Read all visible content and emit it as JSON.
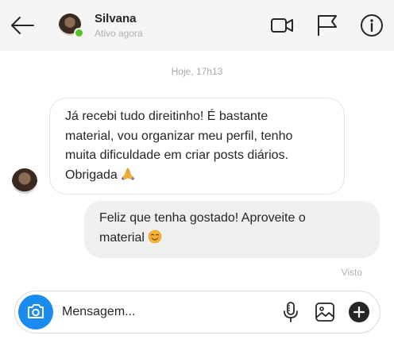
{
  "header": {
    "contact_name": "Silvana",
    "contact_status": "Ativo agora",
    "icons": [
      "back-arrow-icon",
      "video-call-icon",
      "flag-icon",
      "info-icon"
    ]
  },
  "conversation": {
    "timestamp": "Hoje, 17h13",
    "messages": [
      {
        "direction": "incoming",
        "lines": [
          "Já recebi tudo direitinho! É bastante",
          "material, vou organizar meu perfil, tenho",
          "muita dificuldade em criar posts diários.",
          "Obrigada"
        ],
        "emoji": "praying-hands-emoji"
      },
      {
        "direction": "outgoing",
        "lines": [
          "Feliz que tenha gostado! Aproveite o",
          "material"
        ],
        "emoji": "smiling-face-emoji"
      }
    ],
    "seen_label": "Visto"
  },
  "composer": {
    "placeholder": "Mensagem...",
    "icons": [
      "camera-icon",
      "microphone-icon",
      "image-icon",
      "add-icon"
    ]
  },
  "colors": {
    "header_bg": "#f5f5f5",
    "online": "#58c322",
    "camera_button": "#1a8cf0",
    "outgoing_bubble": "#efefef"
  }
}
